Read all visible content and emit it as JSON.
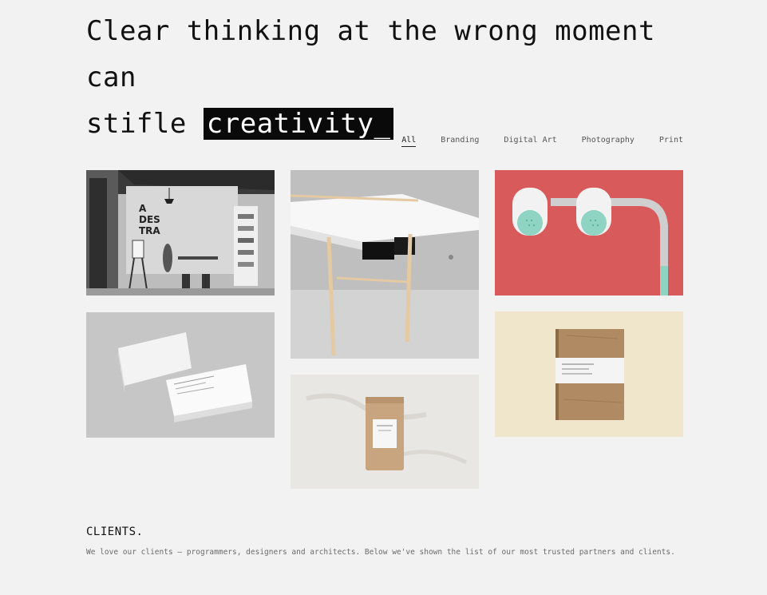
{
  "hero": {
    "line1": "Clear thinking at the wrong moment can",
    "line2_prefix": "stifle ",
    "highlight": "creativity_"
  },
  "filters": [
    {
      "label": "All",
      "active": true
    },
    {
      "label": "Branding",
      "active": false
    },
    {
      "label": "Digital Art",
      "active": false
    },
    {
      "label": "Photography",
      "active": false
    },
    {
      "label": "Print",
      "active": false
    }
  ],
  "portfolio": [
    {
      "subject": "studio-interior"
    },
    {
      "subject": "white-desk"
    },
    {
      "subject": "mint-lamps"
    },
    {
      "subject": "business-cards"
    },
    {
      "subject": "kraft-coffee-bag"
    },
    {
      "subject": "wooden-notebook"
    }
  ],
  "clients": {
    "title": "CLIENTS.",
    "description": "We love our clients – programmers, designers and architects. Below we've shown the list of our most trusted partners and clients."
  },
  "colors": {
    "background": "#f2f2f2",
    "highlight_bg": "#0a0a0a",
    "lamp_red": "#d95a5a",
    "lamp_mint": "#8fd3c3"
  }
}
